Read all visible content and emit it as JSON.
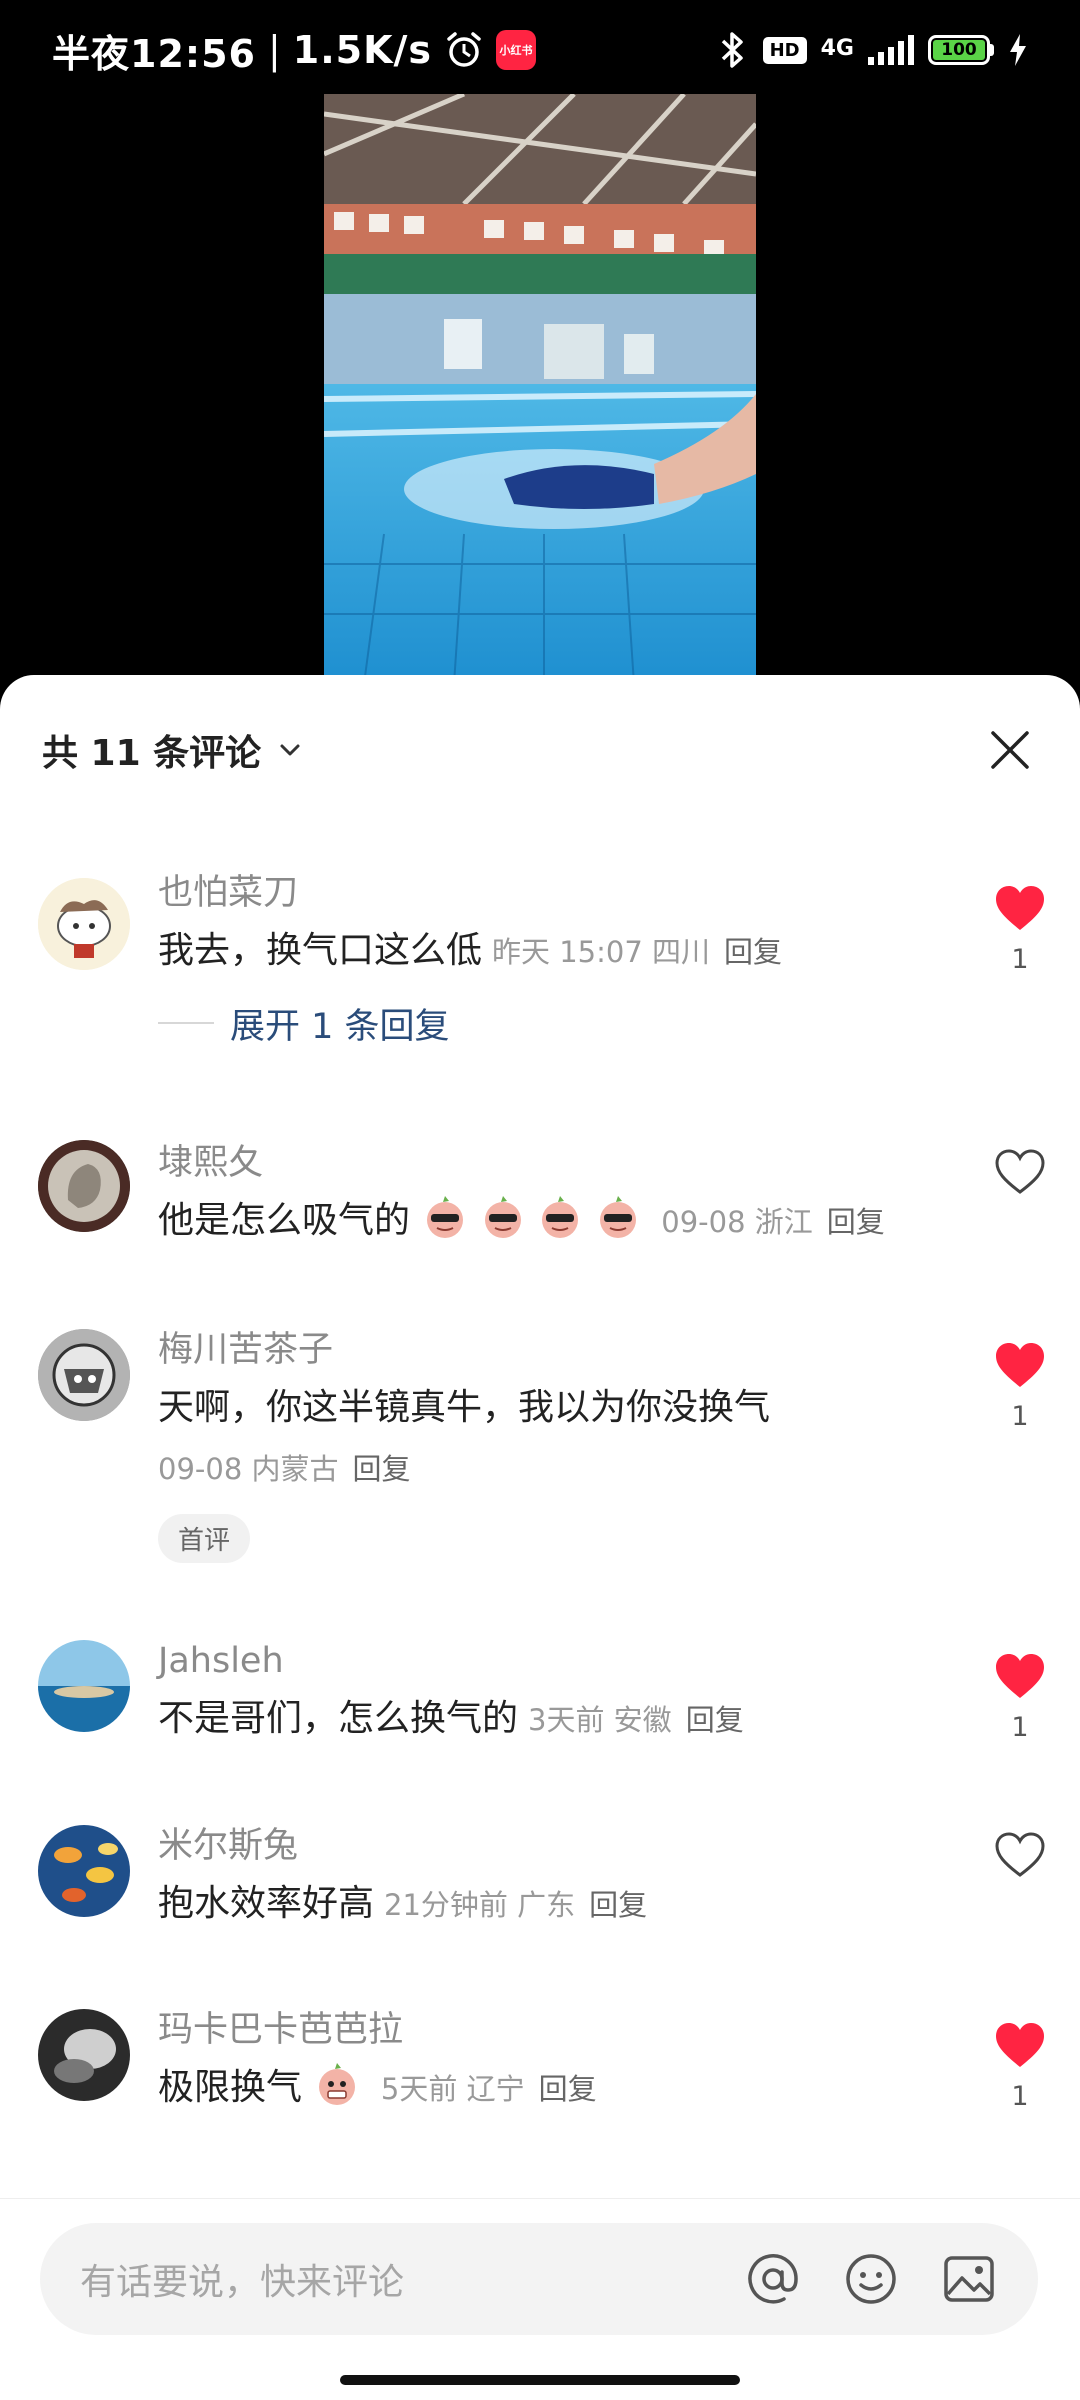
{
  "status_bar": {
    "time": "半夜12:56",
    "net_speed": "1.5K/s",
    "app_badge": "小红书",
    "network": "4G",
    "battery": "100",
    "hd": "HD"
  },
  "header": {
    "count_label": "共 11 条评论"
  },
  "comments": [
    {
      "user": "也怕菜刀",
      "text": "我去，换气口这么低",
      "meta": "昨天 15:07 四川",
      "reply": "回复",
      "likes": "1",
      "liked": true,
      "expand": "展开 1 条回复"
    },
    {
      "user": "埭熙夂",
      "text": "他是怎么吸气的",
      "meta": "09-08 浙江",
      "reply": "回复",
      "likes": "",
      "liked": false
    },
    {
      "user": "梅川苦茶子",
      "text": "天啊，你这半镜真牛，我以为你没换气",
      "meta": "09-08 内蒙古",
      "reply": "回复",
      "likes": "1",
      "liked": true,
      "tag": "首评"
    },
    {
      "user": "Jahsleh",
      "text": "不是哥们，怎么换气的",
      "meta": "3天前 安徽",
      "reply": "回复",
      "likes": "1",
      "liked": true
    },
    {
      "user": "米尔斯兔",
      "text": "抱水效率好高",
      "meta": "21分钟前 广东",
      "reply": "回复",
      "likes": "",
      "liked": false
    },
    {
      "user": "玛卡巴卡芭芭拉",
      "text": "极限换气",
      "meta": "5天前 辽宁",
      "reply": "回复",
      "likes": "1",
      "liked": true
    }
  ],
  "input": {
    "placeholder": "有话要说，快来评论"
  },
  "colors": {
    "like_red": "#ff2442",
    "expand_blue": "#2a4c7a"
  }
}
